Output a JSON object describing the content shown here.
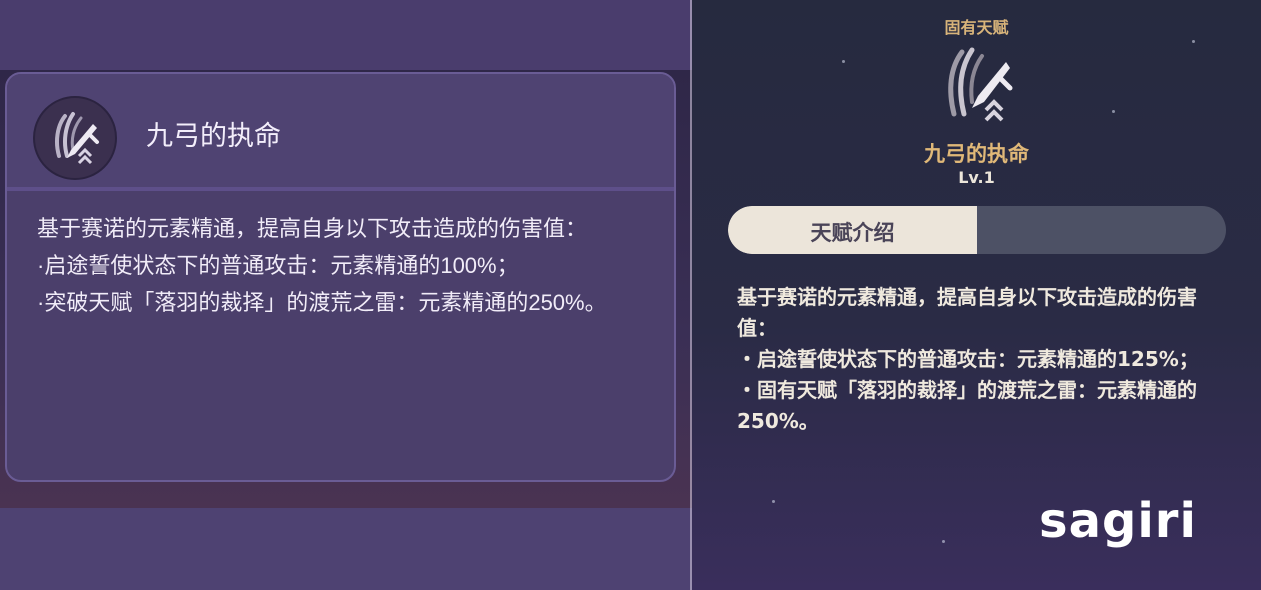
{
  "left_card": {
    "title": "九弓的执命",
    "body": [
      "基于赛诺的元素精通，提高自身以下攻击造成的伤害值：",
      "·启途誓使状态下的普通攻击：元素精通的100%；",
      "·突破天赋「落羽的裁择」的渡荒之雷：元素精通的250%。"
    ]
  },
  "right_panel": {
    "category": "固有天赋",
    "name": "九弓的执命",
    "level": "Lv.1",
    "tab_label": "天赋介绍",
    "body": [
      "基于赛诺的元素精通，提高自身以下攻击造成的伤害值：",
      "・启途誓使状态下的普通攻击：元素精通的125%；",
      "・固有天赋「落羽的裁择」的渡荒之雷：元素精通的250%。"
    ],
    "watermark": "sagiri"
  },
  "icons": {
    "talent": "claw-sword-icon"
  },
  "colors": {
    "left_bg": "#473b68",
    "card_border": "#6a5c95",
    "right_bg": "#262a3f",
    "gold": "#e0b878",
    "tab_active": "#ece5da",
    "tab_inactive": "#4d5165"
  }
}
